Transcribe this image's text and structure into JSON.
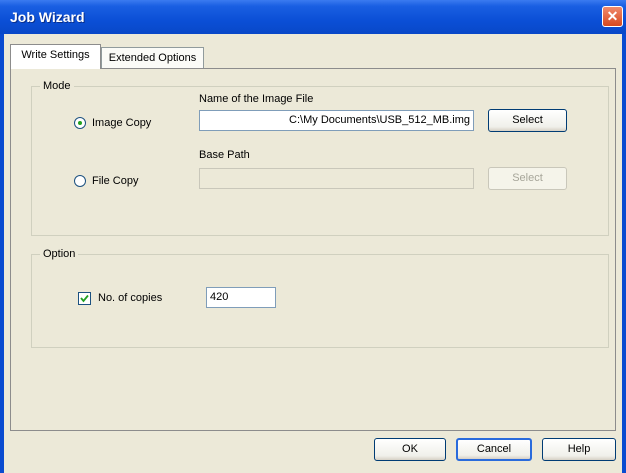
{
  "window": {
    "title": "Job Wizard",
    "close_glyph": "✕"
  },
  "tabs": [
    {
      "label": "Write Settings",
      "active": true
    },
    {
      "label": "Extended Options",
      "active": false
    }
  ],
  "mode": {
    "label": "Mode",
    "image_copy": {
      "label": "Image Copy",
      "selected": true
    },
    "file_copy": {
      "label": "File Copy",
      "selected": false
    },
    "image_file_label": "Name of the Image File",
    "image_file_value": "C:\\My Documents\\USB_512_MB.img",
    "image_select_label": "Select",
    "base_path_label": "Base Path",
    "base_path_value": "",
    "base_select_label": "Select"
  },
  "option": {
    "label": "Option",
    "copies_label": "No. of copies",
    "copies_checked": true,
    "copies_value": "420"
  },
  "buttons": {
    "ok": "OK",
    "cancel": "Cancel",
    "help": "Help"
  },
  "colors": {
    "titlebar": "#0b4fd6",
    "dialog_bg": "#ece9d8",
    "close": "#d6481f",
    "radio_dot": "#21a121"
  }
}
